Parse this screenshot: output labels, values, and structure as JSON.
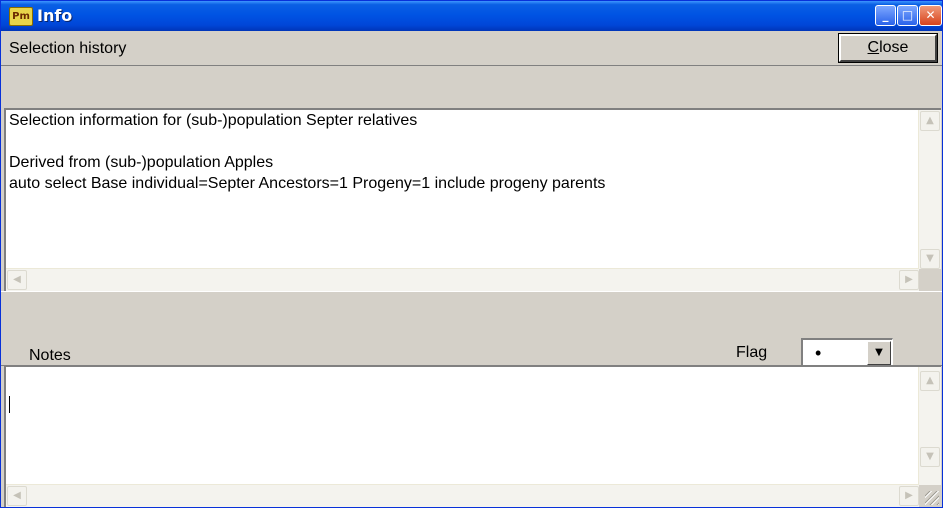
{
  "window": {
    "title": "Info",
    "app_icon_text": "Pm"
  },
  "titlebar_buttons": {
    "minimize": "_",
    "maximize": "□",
    "close": "✕"
  },
  "selection_history": {
    "label": "Selection history",
    "close_button": {
      "accel": "C",
      "rest": "lose"
    },
    "text_lines": [
      "Selection information for (sub-)population Septer relatives",
      "",
      "Derived from (sub-)population Apples",
      "auto select Base individual=Septer Ancestors=1 Progeny=1 include progeny parents"
    ]
  },
  "notes": {
    "label": "Notes",
    "flag_label": "Flag",
    "flag_value": "•",
    "text": ""
  },
  "icons": {
    "scroll_up": "up-arrow-icon",
    "scroll_down": "down-arrow-icon",
    "scroll_left": "left-arrow-icon",
    "scroll_right": "right-arrow-icon",
    "dropdown": "chevron-down-icon"
  }
}
